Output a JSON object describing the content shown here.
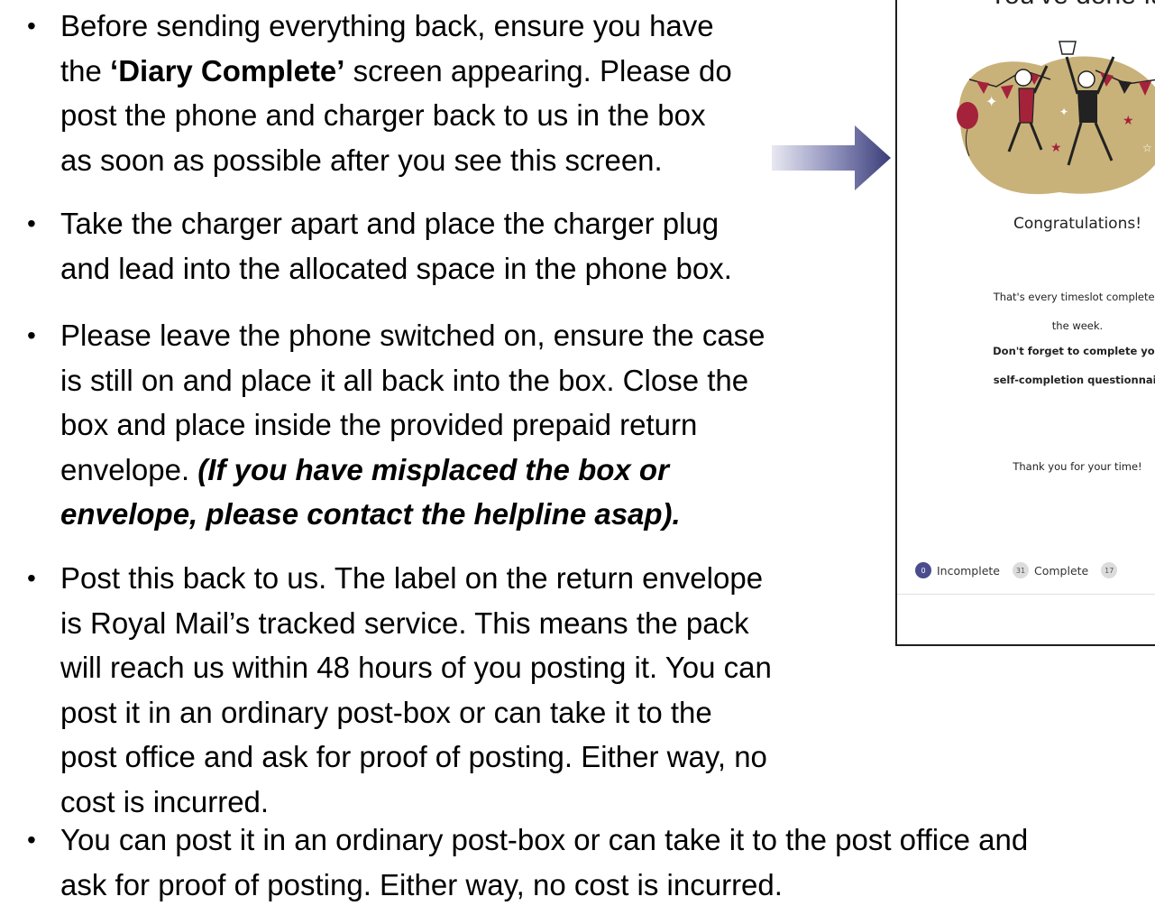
{
  "bullets": [
    {
      "lines": [
        [
          "Before sending everything back, ensure you have"
        ],
        [
          "the ",
          {
            "b": "‘Diary Complete’"
          },
          " screen appearing. Please do"
        ],
        [
          "post the phone and charger back to us in the box"
        ],
        [
          "as soon as possible after you see this screen."
        ]
      ]
    },
    {
      "lines": [
        [
          "Take the charger apart and place the charger plug"
        ],
        [
          "and lead into the allocated space in the phone box."
        ]
      ]
    },
    {
      "lines": [
        [
          "Please leave the phone switched on, ensure the case"
        ],
        [
          "is still on and place it all back into the box. Close the"
        ],
        [
          "box and place inside the provided prepaid return"
        ],
        [
          "envelope. ",
          {
            "bi": "(If you have misplaced the box or"
          }
        ],
        [
          {
            "bi": "envelope, please contact the helpline asap)."
          }
        ]
      ]
    },
    {
      "lines": [
        [
          "Post this back to us. The label on the return envelope"
        ],
        [
          "is Royal Mail’s tracked service. This means the pack"
        ],
        [
          "will reach us within 48 hours of you posting it. You can"
        ],
        [
          "post it in an ordinary post-box or can take it to the"
        ],
        [
          "post office and ask for proof of posting. Either way, no"
        ],
        [
          "cost is incurred."
        ]
      ]
    },
    {
      "lines": [
        [
          "You can post it in an ordinary post-box or can take it to the post office and"
        ],
        [
          "ask for proof of posting. Either way, no cost is incurred."
        ]
      ]
    }
  ],
  "bullet_symbol": "•",
  "phone": {
    "heading": "You've done fa",
    "congrats": "Congratulations!",
    "message_lines": [
      "That's every timeslot complete f",
      "the week."
    ],
    "reminder_lines": [
      "Don't forget to complete you",
      "self-completion questionnair"
    ],
    "thanks": "Thank you for your time!",
    "status": {
      "incomplete_count": "0",
      "incomplete_label": "Incomplete",
      "complete_count": "31",
      "complete_label": "Complete",
      "other_count": "17"
    }
  },
  "colors": {
    "arrow_dark": "#3a3d78",
    "arrow_light": "#e8e8f2",
    "chip_accent": "#4a4c8e",
    "illustration_gold": "#c9b27a",
    "illustration_red": "#a5223b"
  },
  "icons": [
    "arrow-right-icon",
    "celebration-illustration"
  ]
}
